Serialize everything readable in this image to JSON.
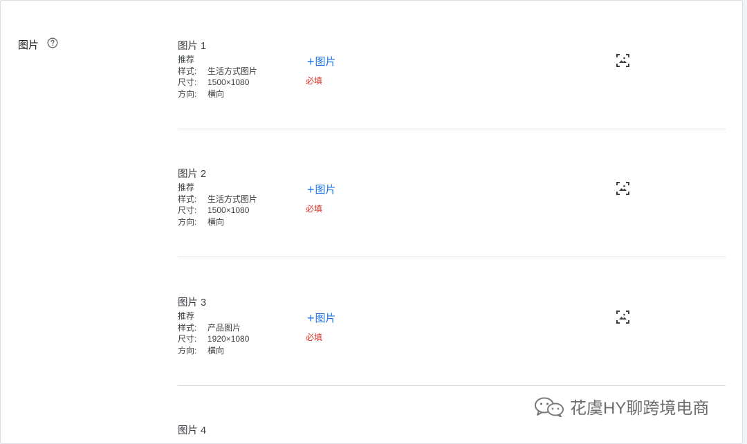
{
  "section": {
    "label": "图片",
    "help_icon": "help-circle-icon"
  },
  "slots": [
    {
      "title": "图片 1",
      "recommend": "推荐",
      "style_key": "样式:",
      "style_val": "生活方式图片",
      "size_key": "尺寸:",
      "size_val": "1500×1080",
      "orient_key": "方向:",
      "orient_val": "横向",
      "add_label": "图片",
      "required": "必填"
    },
    {
      "title": "图片 2",
      "recommend": "推荐",
      "style_key": "样式:",
      "style_val": "生活方式图片",
      "size_key": "尺寸:",
      "size_val": "1500×1080",
      "orient_key": "方向:",
      "orient_val": "横向",
      "add_label": "图片",
      "required": "必填"
    },
    {
      "title": "图片 3",
      "recommend": "推荐",
      "style_key": "样式:",
      "style_val": "产品图片",
      "size_key": "尺寸:",
      "size_val": "1920×1080",
      "orient_key": "方向:",
      "orient_val": "横向",
      "add_label": "图片",
      "required": "必填"
    },
    {
      "title": "图片 4"
    }
  ],
  "watermark": {
    "text": "花虞HY聊跨境电商",
    "icon": "wechat-icon"
  },
  "colors": {
    "link": "#1a73e8",
    "required": "#d93025",
    "text": "#3c4043"
  }
}
